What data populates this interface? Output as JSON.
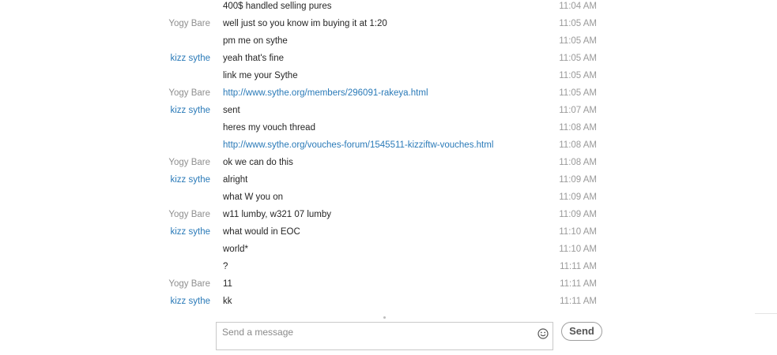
{
  "messages": [
    {
      "sender": "",
      "text": "400$ handled selling pures",
      "time": "11:04 AM",
      "link": false
    },
    {
      "sender": "Yogy Bare",
      "text": "well just so you know im buying it at 1:20",
      "time": "11:05 AM",
      "link": false
    },
    {
      "sender": "",
      "text": "pm me on sythe",
      "time": "11:05 AM",
      "link": false
    },
    {
      "sender": "kizz sythe",
      "text": "yeah that's fine",
      "time": "11:05 AM",
      "link": false
    },
    {
      "sender": "",
      "text": "link me your Sythe",
      "time": "11:05 AM",
      "link": false
    },
    {
      "sender": "Yogy Bare",
      "text": "http://www.sythe.org/members/296091-rakeya.html",
      "time": "11:05 AM",
      "link": true
    },
    {
      "sender": "kizz sythe",
      "text": "sent",
      "time": "11:07 AM",
      "link": false
    },
    {
      "sender": "",
      "text": "heres my vouch thread",
      "time": "11:08 AM",
      "link": false
    },
    {
      "sender": "",
      "text": "http://www.sythe.org/vouches-forum/1545511-kizziftw-vouches.html",
      "time": "11:08 AM",
      "link": true
    },
    {
      "sender": "Yogy Bare",
      "text": "ok we can do this",
      "time": "11:08 AM",
      "link": false
    },
    {
      "sender": "kizz sythe",
      "text": "alright",
      "time": "11:09 AM",
      "link": false
    },
    {
      "sender": "",
      "text": "what W you on",
      "time": "11:09 AM",
      "link": false
    },
    {
      "sender": "Yogy Bare",
      "text": "w11 lumby, w321 07 lumby",
      "time": "11:09 AM",
      "link": false
    },
    {
      "sender": "kizz sythe",
      "text": "what would in EOC",
      "time": "11:10 AM",
      "link": false
    },
    {
      "sender": "",
      "text": "world*",
      "time": "11:10 AM",
      "link": false
    },
    {
      "sender": "",
      "text": "?",
      "time": "11:11 AM",
      "link": false
    },
    {
      "sender": "Yogy Bare",
      "text": "11",
      "time": "11:11 AM",
      "link": false
    },
    {
      "sender": "kizz sythe",
      "text": "kk",
      "time": "11:11 AM",
      "link": false
    }
  ],
  "composer": {
    "placeholder": "Send a message",
    "emoji_icon": "smiley-icon",
    "send_label": "Send"
  },
  "colors": {
    "contact_name": "#8f8f8f",
    "self_name": "#2a7ab8",
    "link": "#2a7ab8",
    "message_text": "#262626",
    "timestamp": "#9a9a9a"
  }
}
